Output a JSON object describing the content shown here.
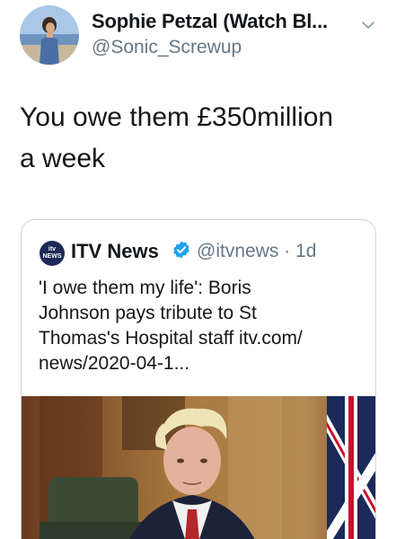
{
  "tweet": {
    "display_name": "Sophie Petzal (Watch Bl...",
    "handle": "@Sonic_Screwup",
    "text_lines": [
      "You owe them £350million",
      "a week"
    ]
  },
  "quoted_tweet": {
    "logo_text": "itv NEWS",
    "name": "ITV News",
    "handle": "@itvnews",
    "separator": "·",
    "time": "1d",
    "text_lines": [
      "'I owe them my life': Boris",
      "Johnson pays tribute to St",
      "Thomas's Hospital staff itv.com/",
      "news/2020-04-1..."
    ]
  },
  "icons": {
    "chevron": "chevron-down-icon",
    "verified": "verified-badge-icon"
  },
  "colors": {
    "text": "#14171a",
    "secondary": "#657786",
    "verified": "#1da1f2",
    "border": "#ccd6dd"
  }
}
